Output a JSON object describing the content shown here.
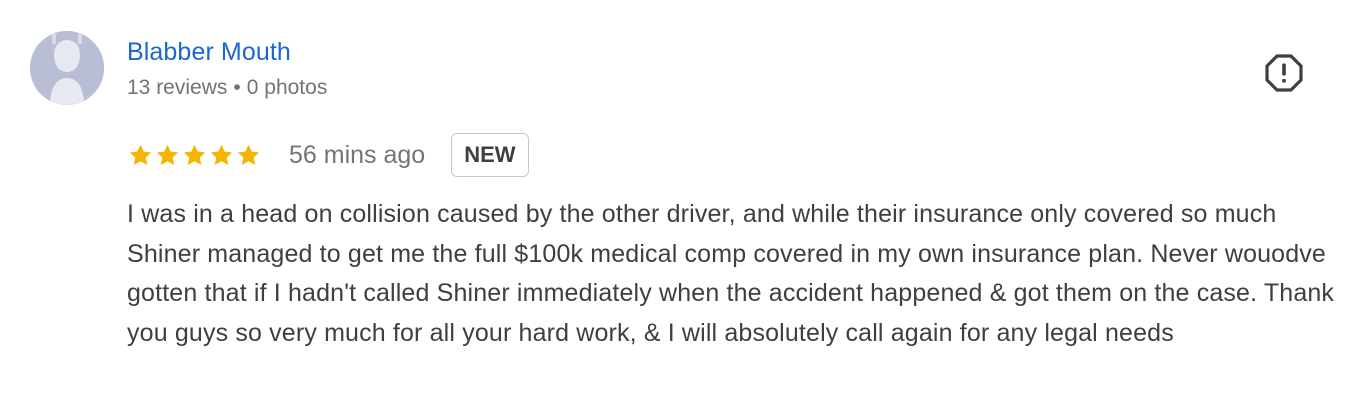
{
  "review": {
    "author": {
      "name": "Blabber Mouth",
      "reviews_count": "13 reviews",
      "separator": "•",
      "photos_count": "0 photos",
      "avatar_icon": "default-avatar-icon"
    },
    "report_icon": "report-flag-icon",
    "rating": {
      "stars": 5,
      "max_stars": 5,
      "star_color": "#f4b400"
    },
    "time_ago": "56 mins ago",
    "badge": "NEW",
    "text": "I was in a head on collision caused by the other driver, and while their insurance only covered so much Shiner managed to get me the full $100k medical comp covered in my own insurance plan. Never wouodve gotten that if I hadn't called Shiner immediately when the accident happened & got them on the case. Thank you guys so very much for all your hard work, & I will absolutely call again for any legal needs"
  },
  "colors": {
    "author_link": "#1a66d2",
    "meta_gray": "#70757a",
    "text": "#3c4043",
    "avatar_bg": "#b9bdd6"
  }
}
